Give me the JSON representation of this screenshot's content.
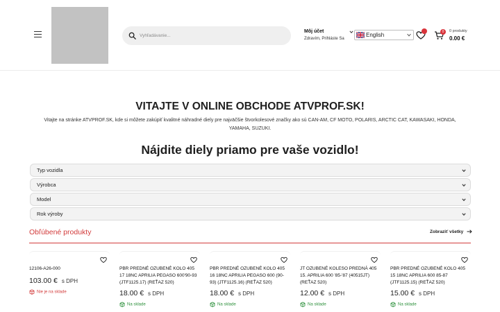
{
  "header": {
    "search_placeholder": "Vyhľadávanie...",
    "account_title": "Môj účet",
    "account_subtitle": "Zdravím, Prihláste Sa",
    "language": "English",
    "wishlist_count": "",
    "cart_count": "0",
    "cart_items_label": "0 produkty",
    "cart_total": "0.00 €"
  },
  "intro": {
    "title": "VITAJTE V ONLINE OBCHODE ATVPROF.SK!",
    "text": "Vitajte na stránke ATVPROF.SK, kde si môžete zakúpiť kvalitné náhradné diely pre najväčšie štvorkolesové značky ako sú CAN-AM, CF MOTO, POLARIS, ARCTIC CAT, KAWASAKI, HONDA, YAMAHA, SUZUKI."
  },
  "finder": {
    "title": "Nájdite diely priamo pre vaše vozidlo!",
    "selects": [
      {
        "label": "Typ vozidla"
      },
      {
        "label": "Výrobca"
      },
      {
        "label": "Model"
      },
      {
        "label": "Rok výroby"
      }
    ]
  },
  "products_section": {
    "title": "Obľúbené produkty",
    "show_all": "Zobraziť všetky",
    "items": [
      {
        "name": "12106-A26-000",
        "price": "103.00 €",
        "vat": "s DPH",
        "stock": "Nie je na sklade",
        "in_stock": false
      },
      {
        "name": "PBR PREDNÉ OZUBENÉ KOLO 405 17 18NC APRILIA PEGASO 600'90-93 (JTF1125.17) (REŤAZ 520)",
        "price": "18.00 €",
        "vat": "s DPH",
        "stock": "Na sklade",
        "in_stock": true
      },
      {
        "name": "PBR PREDNÉ OZUBENÉ KOLO 405 16 18NC APRILIA PEGASO 600 (90-93) (JTF1125.16) (REŤAZ 520)",
        "price": "18.00 €",
        "vat": "s DPH",
        "stock": "Na sklade",
        "in_stock": true
      },
      {
        "name": "JT OZUBENÉ KOLESO PREDNÁ 405 15. APRILIA 600 '85-'87 (40515JT) (REŤAZ 520)",
        "price": "12.00 €",
        "vat": "s DPH",
        "stock": "Na sklade",
        "in_stock": true
      },
      {
        "name": "PBR PREDNÉ OZUBENÉ KOLO 405 15 18NC APRILIA 600 85-87 (JTF1125.15) (REŤAZ 520)",
        "price": "15.00 €",
        "vat": "s DPH",
        "stock": "Na sklade",
        "in_stock": true
      }
    ]
  },
  "colors": {
    "accent": "#d23b3b",
    "in_stock": "#2b8f3a"
  }
}
